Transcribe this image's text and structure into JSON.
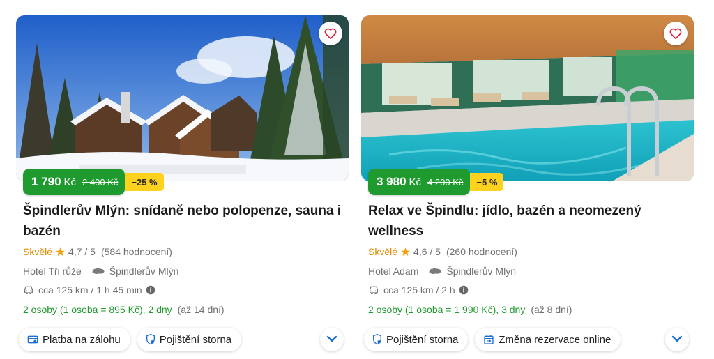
{
  "colors": {
    "price_green": "#1f9a2e",
    "discount_yellow": "#ffd21f",
    "rating_orange": "#e08a00",
    "icon_blue": "#1d6fd0",
    "heart_red": "#d81f3a"
  },
  "icons": {
    "favorite": "heart-icon",
    "rating": "star-icon",
    "location": "map-pin-icon",
    "travel": "car-icon",
    "info": "info-icon",
    "deposit": "card-icon",
    "insurance": "shield-icon",
    "rebooking": "calendar-swap-icon",
    "expand": "chevron-down-icon"
  },
  "offers": [
    {
      "price": "1 790",
      "currency": "Kč",
      "old_price": "2 400 Kč",
      "discount": "−25 %",
      "title": "Špindlerův Mlýn: snídaně nebo polopenze, sauna i bazén",
      "rating_word": "Skvělé",
      "rating": "4,7 / 5",
      "reviews": "(584 hodnocení)",
      "hotel": "Hotel Tři růže",
      "location": "Špindlerův Mlýn",
      "travel": "cca 125 km / 1 h 45 min",
      "offer_text": "2 osoby (1 osoba = 895 Kč), 2 dny",
      "offer_range": "(až 14 dní)",
      "chips": [
        "Platba na zálohu",
        "Pojištění storna"
      ]
    },
    {
      "price": "3 980",
      "currency": "Kč",
      "old_price": "4 200 Kč",
      "discount": "−5 %",
      "title": "Relax ve Špindlu: jídlo, bazén a neomezený wellness",
      "rating_word": "Skvělé",
      "rating": "4,6 / 5",
      "reviews": "(260 hodnocení)",
      "hotel": "Hotel Adam",
      "location": "Špindlerův Mlýn",
      "travel": "cca 125 km / 2 h",
      "offer_text": "2 osoby (1 osoba = 1 990 Kč), 3 dny",
      "offer_range": "(až 8 dní)",
      "chips": [
        "Pojištění storna",
        "Změna rezervace online"
      ]
    }
  ]
}
